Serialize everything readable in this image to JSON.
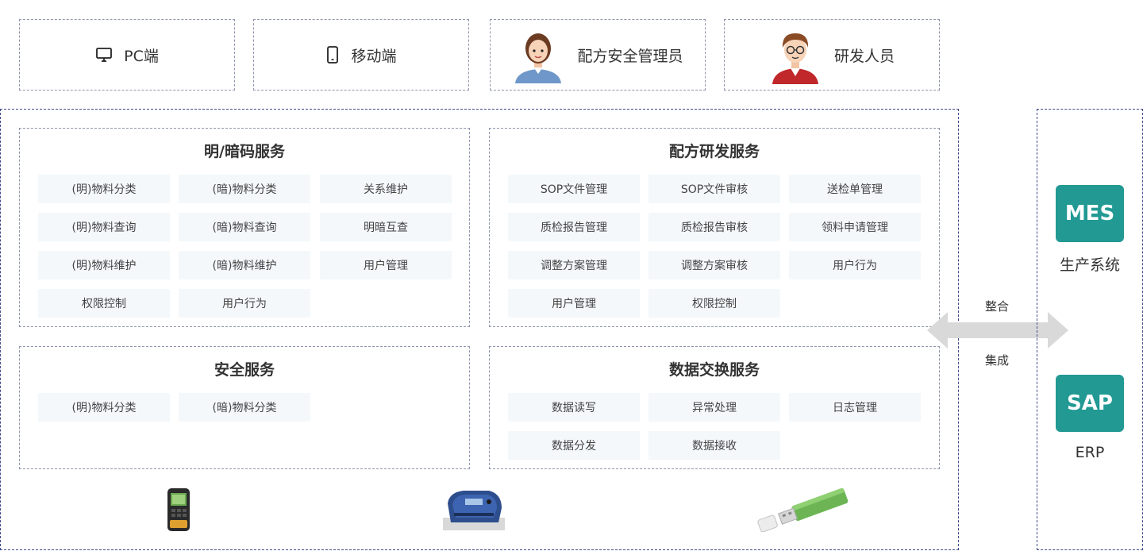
{
  "roles": [
    {
      "label": "PC端",
      "icon": "monitor-icon"
    },
    {
      "label": "移动端",
      "icon": "mobile-phone-icon"
    },
    {
      "label": "配方安全管理员",
      "icon": "female-avatar-icon"
    },
    {
      "label": "研发人员",
      "icon": "male-avatar-icon"
    }
  ],
  "panels": {
    "code_service": {
      "title": "明/暗码服务",
      "items": [
        "(明)物料分类",
        "(暗)物料分类",
        "关系维护",
        "(明)物料查询",
        "(暗)物料查询",
        "明暗互查",
        "(明)物料维护",
        "(暗)物料维护",
        "用户管理",
        "权限控制",
        "用户行为"
      ]
    },
    "rd_service": {
      "title": "配方研发服务",
      "items": [
        "SOP文件管理",
        "SOP文件审核",
        "送检单管理",
        "质检报告管理",
        "质检报告审核",
        "领料申请管理",
        "调整方案管理",
        "调整方案审核",
        "用户行为",
        "用户管理",
        "权限控制"
      ]
    },
    "security_service": {
      "title": "安全服务",
      "items": [
        "(明)物料分类",
        "(暗)物料分类"
      ]
    },
    "exchange_service": {
      "title": "数据交换服务",
      "items": [
        "数据读写",
        "异常处理",
        "日志管理",
        "数据分发",
        "数据接收"
      ]
    }
  },
  "integration": {
    "top_label": "整合",
    "bottom_label": "集成",
    "arrow_color": "#d9d9d9"
  },
  "external_systems": [
    {
      "badge": "MES",
      "label": "生产系统"
    },
    {
      "badge": "SAP",
      "label": "ERP"
    }
  ],
  "devices": [
    {
      "icon": "handheld-scanner-icon"
    },
    {
      "icon": "label-printer-icon"
    },
    {
      "icon": "usb-drive-icon"
    }
  ],
  "colors": {
    "accent_teal": "#229993",
    "chip_bg": "#f4f8fb",
    "dash_border": "#3d4a8a"
  }
}
